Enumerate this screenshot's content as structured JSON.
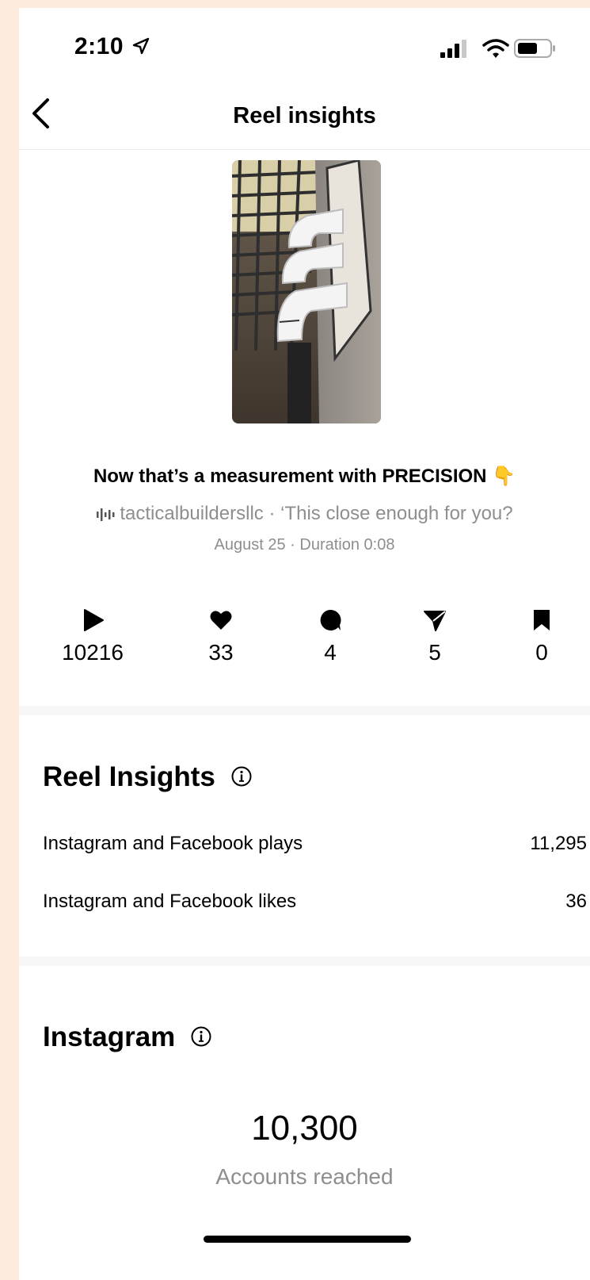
{
  "status_bar": {
    "time": "2:10",
    "icons": [
      "location-arrow-icon",
      "signal-icon",
      "wifi-icon",
      "battery-icon"
    ]
  },
  "header": {
    "back_icon": "chevron-left-icon",
    "title": "Reel insights"
  },
  "reel": {
    "thumbnail_icon": "reel-thumbnail",
    "caption": "Now that’s a measurement with PRECISION 👇",
    "audio_text": "tacticalbuildersllc · ‘This close enough for you?",
    "meta": "August 25 · Duration 0:08"
  },
  "stats": [
    {
      "icon": "play-icon",
      "value": "10216"
    },
    {
      "icon": "heart-icon",
      "value": "33"
    },
    {
      "icon": "comment-icon",
      "value": "4"
    },
    {
      "icon": "share-icon",
      "value": "5"
    },
    {
      "icon": "bookmark-icon",
      "value": "0"
    }
  ],
  "reel_insights": {
    "title": "Reel Insights",
    "rows": [
      {
        "label": "Instagram and Facebook plays",
        "value": "11,295"
      },
      {
        "label": "Instagram and Facebook likes",
        "value": "36"
      }
    ]
  },
  "instagram": {
    "title": "Instagram",
    "accounts_reached": "10,300",
    "accounts_reached_label": "Accounts reached"
  },
  "colors": {
    "background": "#fdebdd",
    "muted_text": "#8e8e8e",
    "divider": "#f7f7f7"
  }
}
